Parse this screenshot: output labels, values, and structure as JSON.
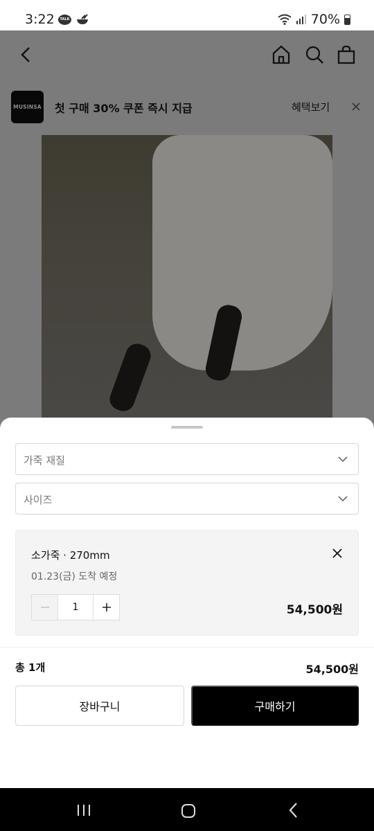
{
  "status_bar": {
    "time": "3:22",
    "battery": "70%",
    "icons": [
      "kakaotalk-icon",
      "bowl-icon",
      "wifi-icon",
      "signal-icon",
      "battery-icon"
    ]
  },
  "header": {
    "icons": [
      "back-icon",
      "home-icon",
      "search-icon",
      "shopping-bag-icon"
    ]
  },
  "promo": {
    "logo_text": "MUSINSA",
    "message": "첫 구매 30% 쿠폰 즉시 지급",
    "link": "혜택보기"
  },
  "sheet": {
    "select_material": "가죽 재질",
    "select_size": "사이즈",
    "selected_option": {
      "name": "소가죽 · 270mm",
      "eta": "01.23(금) 도착 예정",
      "quantity": "1",
      "price": "54,500원"
    },
    "total_label": "총 1개",
    "total_price": "54,500원",
    "cart_button": "장바구니",
    "buy_button": "구매하기"
  },
  "colors": {
    "primary_button": "#000000",
    "overlay": "#7b7b7b",
    "sheet": "#ffffff"
  }
}
